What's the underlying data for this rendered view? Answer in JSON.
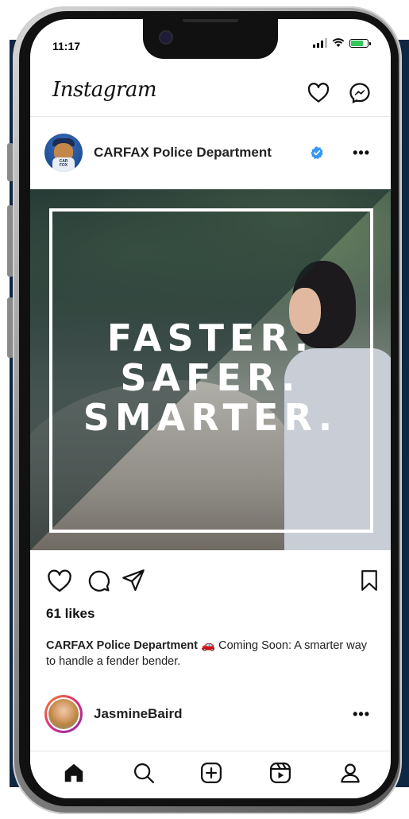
{
  "status_bar": {
    "time": "11:17",
    "battery_level": 0.8
  },
  "header": {
    "logo": "Instagram"
  },
  "post": {
    "username": "CARFAX Police Department",
    "verified": true,
    "avatar_badge": "CAR FOX",
    "image_text": [
      "FASTER.",
      "SAFER.",
      "SMARTER."
    ],
    "likes": "61 likes",
    "caption_user": "CARFAX Police Department",
    "caption_emoji": "🚗",
    "caption_text": " Coming Soon: A smarter way to handle a fender bender."
  },
  "next_post": {
    "username": "JasmineBaird"
  },
  "icons": {
    "header": [
      "heart-icon",
      "messenger-icon"
    ],
    "actions": [
      "heart-icon",
      "comment-icon",
      "share-icon",
      "bookmark-icon"
    ],
    "tabs": [
      "home-icon",
      "search-icon",
      "add-post-icon",
      "reels-icon",
      "profile-icon"
    ]
  },
  "colors": {
    "background_panel": "#0f2742",
    "verified_blue": "#3897f0",
    "story_ring": "#dd2a7b"
  }
}
